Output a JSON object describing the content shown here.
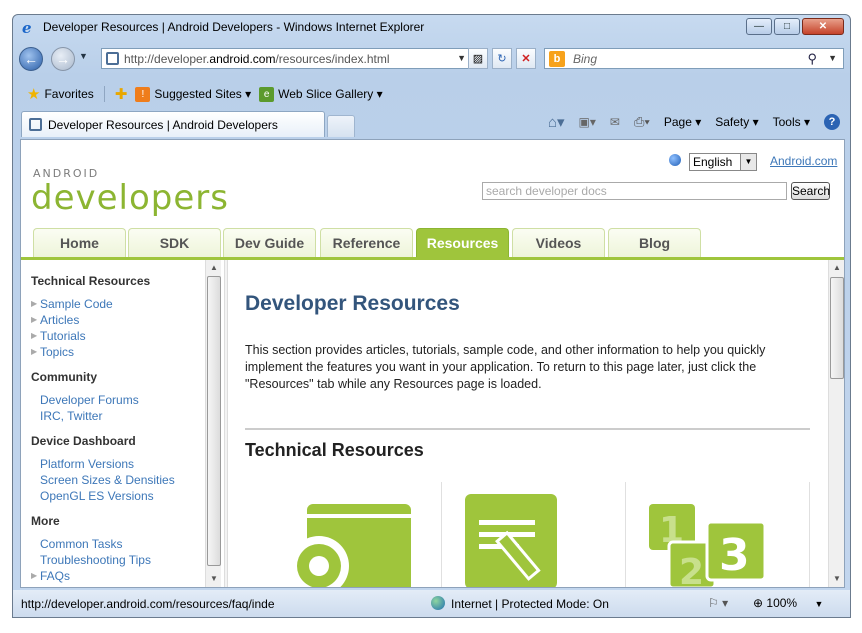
{
  "window": {
    "title": "Developer Resources | Android Developers - Windows Internet Explorer",
    "minimize": "—",
    "maximize": "□",
    "close": "✕"
  },
  "address": {
    "url_prefix": "http://developer.",
    "url_domain": "android.com",
    "url_suffix": "/resources/index.html",
    "search_placeholder": "Bing"
  },
  "favorites": {
    "favorites_label": "Favorites",
    "suggested_sites": "Suggested Sites ▾",
    "web_slice": "Web Slice Gallery ▾"
  },
  "tab": {
    "label": "Developer Resources | Android Developers"
  },
  "commandbar": {
    "page": "Page ▾",
    "safety": "Safety ▾",
    "tools": "Tools ▾"
  },
  "page": {
    "wordmark": "ANDROID",
    "logo": "developers",
    "language": "English",
    "android_link": "Android.com",
    "search_placeholder": "search developer docs",
    "search_button": "Search",
    "tabs": [
      "Home",
      "SDK",
      "Dev Guide",
      "Reference",
      "Resources",
      "Videos",
      "Blog"
    ],
    "active_tab": "Resources",
    "sidebar": {
      "technical_heading": "Technical Resources",
      "technical_items": [
        "Sample Code",
        "Articles",
        "Tutorials",
        "Topics"
      ],
      "community_heading": "Community",
      "community_items": [
        "Developer Forums",
        "IRC, Twitter"
      ],
      "dashboard_heading": "Device Dashboard",
      "dashboard_items": [
        "Platform Versions",
        "Screen Sizes & Densities",
        "OpenGL ES Versions"
      ],
      "more_heading": "More",
      "more_items": [
        "Common Tasks",
        "Troubleshooting Tips",
        "FAQs"
      ]
    },
    "main": {
      "title": "Developer Resources",
      "intro": "This section provides articles, tutorials, sample code, and other information to help you quickly implement the features you want in your application. To return to this page later, just click the \"Resources\" tab while any Resources page is loaded.",
      "section_title": "Technical Resources",
      "tile_number_1": "1",
      "tile_number_2": "2",
      "tile_number_3": "3"
    }
  },
  "status": {
    "url": "http://developer.android.com/resources/faq/inde",
    "zone": "Internet | Protected Mode: On",
    "zoom": "100%"
  },
  "colors": {
    "android_green": "#9fc53c",
    "title_blue": "#33557c",
    "link_blue": "#3d77b8"
  }
}
